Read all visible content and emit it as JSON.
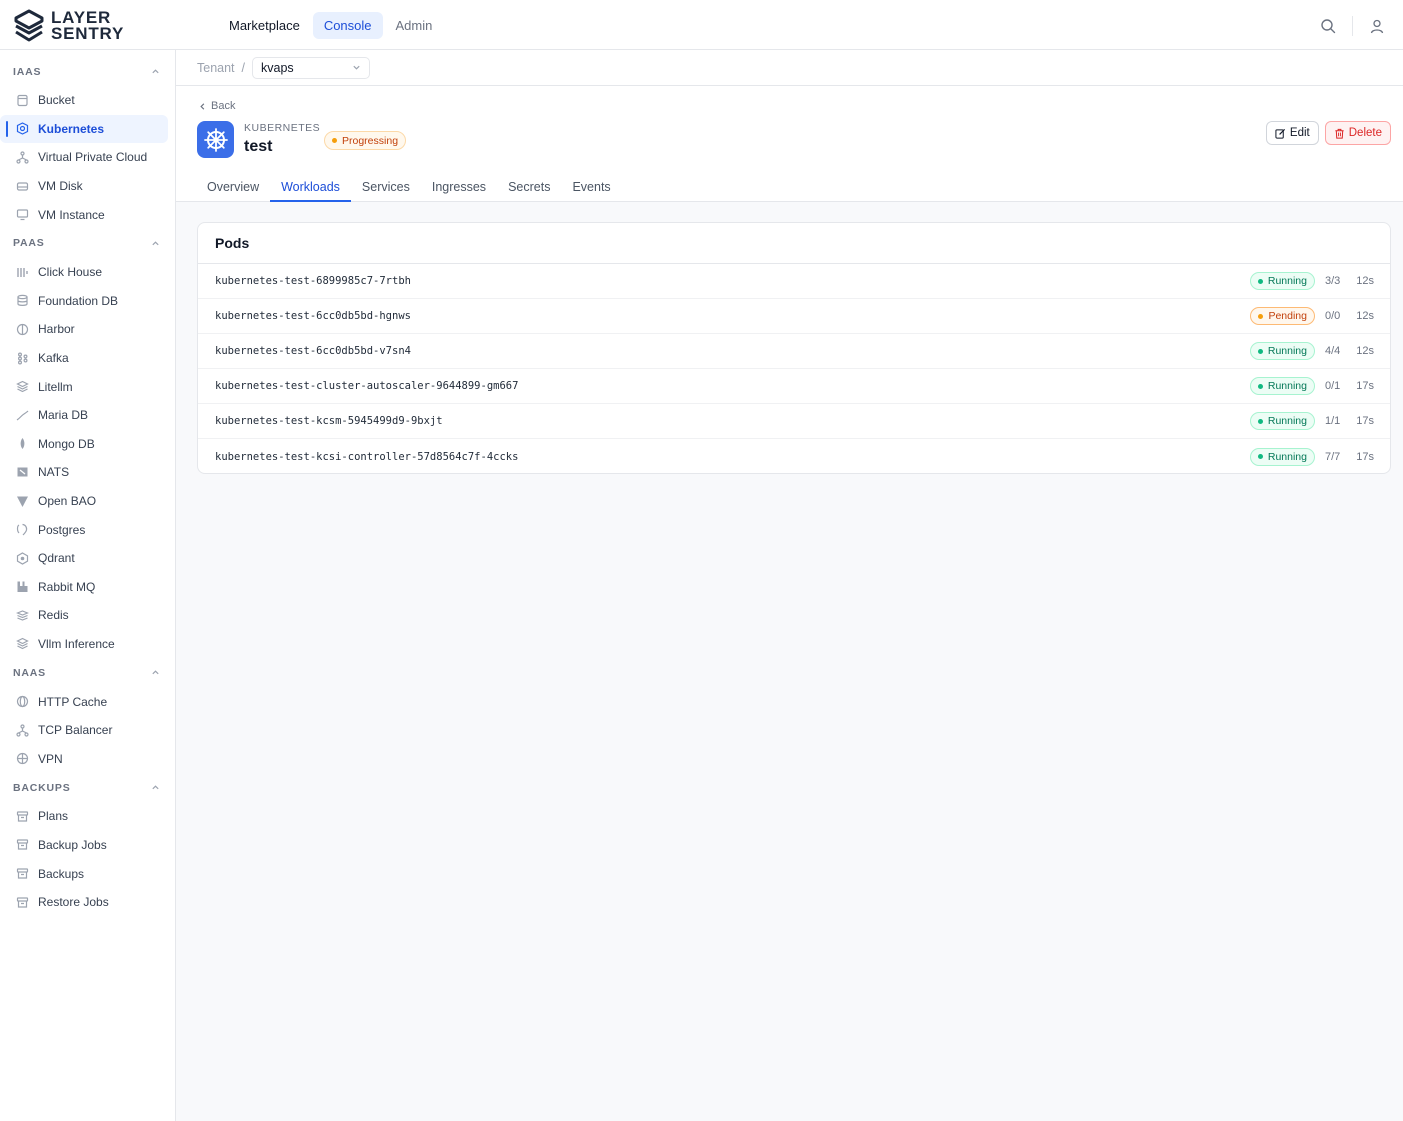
{
  "brand": {
    "line1": "LAYER",
    "line2": "SENTRY"
  },
  "nav": {
    "items": [
      {
        "label": "Marketplace"
      },
      {
        "label": "Console"
      },
      {
        "label": "Admin"
      }
    ]
  },
  "sidebar": {
    "sections": [
      {
        "title": "IAAS",
        "items": [
          {
            "label": "Bucket",
            "icon": "bucket-icon"
          },
          {
            "label": "Kubernetes",
            "icon": "kubernetes-icon"
          },
          {
            "label": "Virtual Private Cloud",
            "icon": "network-icon"
          },
          {
            "label": "VM Disk",
            "icon": "disk-icon"
          },
          {
            "label": "VM Instance",
            "icon": "monitor-icon"
          }
        ]
      },
      {
        "title": "PAAS",
        "items": [
          {
            "label": "Click House",
            "icon": "clickhouse-icon"
          },
          {
            "label": "Foundation DB",
            "icon": "database-icon"
          },
          {
            "label": "Harbor",
            "icon": "harbor-icon"
          },
          {
            "label": "Kafka",
            "icon": "kafka-icon"
          },
          {
            "label": "Litellm",
            "icon": "layers-icon"
          },
          {
            "label": "Maria DB",
            "icon": "mariadb-icon"
          },
          {
            "label": "Mongo DB",
            "icon": "mongodb-icon"
          },
          {
            "label": "NATS",
            "icon": "nats-icon"
          },
          {
            "label": "Open BAO",
            "icon": "openbao-icon"
          },
          {
            "label": "Postgres",
            "icon": "postgres-icon"
          },
          {
            "label": "Qdrant",
            "icon": "qdrant-icon"
          },
          {
            "label": "Rabbit MQ",
            "icon": "rabbitmq-icon"
          },
          {
            "label": "Redis",
            "icon": "redis-icon"
          },
          {
            "label": "Vllm Inference",
            "icon": "layers-icon"
          }
        ]
      },
      {
        "title": "NAAS",
        "items": [
          {
            "label": "HTTP Cache",
            "icon": "globe-icon"
          },
          {
            "label": "TCP Balancer",
            "icon": "network-icon"
          },
          {
            "label": "VPN",
            "icon": "vpn-icon"
          }
        ]
      },
      {
        "title": "BACKUPS",
        "items": [
          {
            "label": "Plans",
            "icon": "archive-icon"
          },
          {
            "label": "Backup Jobs",
            "icon": "archive-icon"
          },
          {
            "label": "Backups",
            "icon": "archive-icon"
          },
          {
            "label": "Restore Jobs",
            "icon": "archive-icon"
          }
        ]
      }
    ]
  },
  "breadcrumb": {
    "root": "Tenant",
    "separator": "/",
    "tenant": "kvaps"
  },
  "resource": {
    "back_label": "Back",
    "type": "KUBERNETES",
    "name": "test",
    "status": "Progressing",
    "edit_label": "Edit",
    "delete_label": "Delete"
  },
  "tabs": [
    {
      "label": "Overview"
    },
    {
      "label": "Workloads"
    },
    {
      "label": "Services"
    },
    {
      "label": "Ingresses"
    },
    {
      "label": "Secrets"
    },
    {
      "label": "Events"
    }
  ],
  "pods": {
    "title": "Pods",
    "rows": [
      {
        "name": "kubernetes-test-6899985c7-7rtbh",
        "status": "Running",
        "ready": "3/3",
        "age": "12s"
      },
      {
        "name": "kubernetes-test-6cc0db5bd-hgnws",
        "status": "Pending",
        "ready": "0/0",
        "age": "12s"
      },
      {
        "name": "kubernetes-test-6cc0db5bd-v7sn4",
        "status": "Running",
        "ready": "4/4",
        "age": "12s"
      },
      {
        "name": "kubernetes-test-cluster-autoscaler-9644899-gm667",
        "status": "Running",
        "ready": "0/1",
        "age": "17s"
      },
      {
        "name": "kubernetes-test-kcsm-5945499d9-9bxjt",
        "status": "Running",
        "ready": "1/1",
        "age": "17s"
      },
      {
        "name": "kubernetes-test-kcsi-controller-57d8564c7f-4ccks",
        "status": "Running",
        "ready": "7/7",
        "age": "17s"
      }
    ]
  },
  "colors": {
    "accent": "#2563eb",
    "running": "#10b981",
    "pending": "#f59e0b",
    "danger": "#dc2626"
  }
}
